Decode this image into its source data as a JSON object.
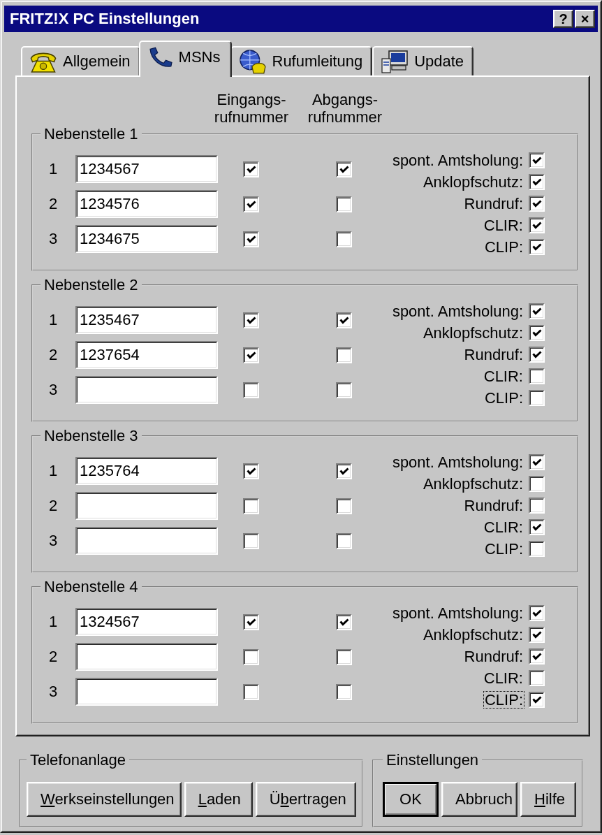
{
  "window": {
    "title": "FRITZ!X PC Einstellungen",
    "controls": [
      {
        "label": "?"
      },
      {
        "label": "×"
      }
    ]
  },
  "tabs": [
    {
      "label": "Allgemein",
      "selected": false
    },
    {
      "label": "MSNs",
      "selected": true
    },
    {
      "label": "Rufumleitung",
      "selected": false
    },
    {
      "label": "Update",
      "selected": false
    }
  ],
  "column_headers": [
    {
      "lines": [
        "Eingangs-",
        "rufnummer"
      ]
    },
    {
      "lines": [
        "Abgangs-",
        "rufnummer"
      ]
    }
  ],
  "extensions": [
    {
      "title": "Nebenstelle 1",
      "rows": [
        {
          "number": "1",
          "value": "1234567",
          "incoming": true,
          "outgoing": true
        },
        {
          "number": "2",
          "value": "1234576",
          "incoming": true,
          "outgoing": false
        },
        {
          "number": "3",
          "value": "1234675",
          "incoming": true,
          "outgoing": false
        }
      ],
      "options": [
        {
          "label": "spont. Amtsholung:",
          "checked": true,
          "focused": false
        },
        {
          "label": "Anklopfschutz:",
          "checked": true,
          "focused": false
        },
        {
          "label": "Rundruf:",
          "checked": true,
          "focused": false
        },
        {
          "label": "CLIR:",
          "checked": true,
          "focused": false
        },
        {
          "label": "CLIP:",
          "checked": true,
          "focused": false
        }
      ]
    },
    {
      "title": "Nebenstelle 2",
      "rows": [
        {
          "number": "1",
          "value": "1235467",
          "incoming": true,
          "outgoing": true
        },
        {
          "number": "2",
          "value": "1237654",
          "incoming": true,
          "outgoing": false
        },
        {
          "number": "3",
          "incoming": false,
          "outgoing": false
        }
      ],
      "options": [
        {
          "label": "spont. Amtsholung:",
          "checked": true,
          "focused": false
        },
        {
          "label": "Anklopfschutz:",
          "checked": true,
          "focused": false
        },
        {
          "label": "Rundruf:",
          "checked": true,
          "focused": false
        },
        {
          "label": "CLIR:",
          "checked": false,
          "focused": false
        },
        {
          "label": "CLIP:",
          "checked": false,
          "focused": false
        }
      ]
    },
    {
      "title": "Nebenstelle 3",
      "rows": [
        {
          "number": "1",
          "value": "1235764",
          "incoming": true,
          "outgoing": true
        },
        {
          "number": "2",
          "incoming": false,
          "outgoing": false
        },
        {
          "number": "3",
          "incoming": false,
          "outgoing": false
        }
      ],
      "options": [
        {
          "label": "spont. Amtsholung:",
          "checked": true,
          "focused": false
        },
        {
          "label": "Anklopfschutz:",
          "checked": false,
          "focused": false
        },
        {
          "label": "Rundruf:",
          "checked": false,
          "focused": false
        },
        {
          "label": "CLIR:",
          "checked": true,
          "focused": false
        },
        {
          "label": "CLIP:",
          "checked": false,
          "focused": false
        }
      ]
    },
    {
      "title": "Nebenstelle 4",
      "rows": [
        {
          "number": "1",
          "value": "1324567",
          "incoming": true,
          "outgoing": true
        },
        {
          "number": "2",
          "incoming": false,
          "outgoing": false
        },
        {
          "number": "3",
          "incoming": false,
          "outgoing": false
        }
      ],
      "options": [
        {
          "label": "spont. Amtsholung:",
          "checked": true,
          "focused": false
        },
        {
          "label": "Anklopfschutz:",
          "checked": true,
          "focused": false
        },
        {
          "label": "Rundruf:",
          "checked": true,
          "focused": false
        },
        {
          "label": "CLIR:",
          "checked": false,
          "focused": false
        },
        {
          "label": "CLIP:",
          "checked": true,
          "focused": true
        }
      ]
    }
  ],
  "footer": {
    "groups": [
      {
        "title": "Telefonanlage",
        "buttons": [
          {
            "access_key": "W",
            "label_after": "erkseinstellungen",
            "default": false
          },
          {
            "access_key": "L",
            "label_after": "aden",
            "default": false
          },
          {
            "label_before": "Ü",
            "access_key": "b",
            "label_after": "ertragen",
            "default": false
          }
        ]
      },
      {
        "title": "Einstellungen",
        "buttons": [
          {
            "label": "OK",
            "default": true
          },
          {
            "label": "Abbruch",
            "default": false
          },
          {
            "access_key": "H",
            "label_after": "ilfe",
            "default": false
          }
        ]
      }
    ]
  }
}
